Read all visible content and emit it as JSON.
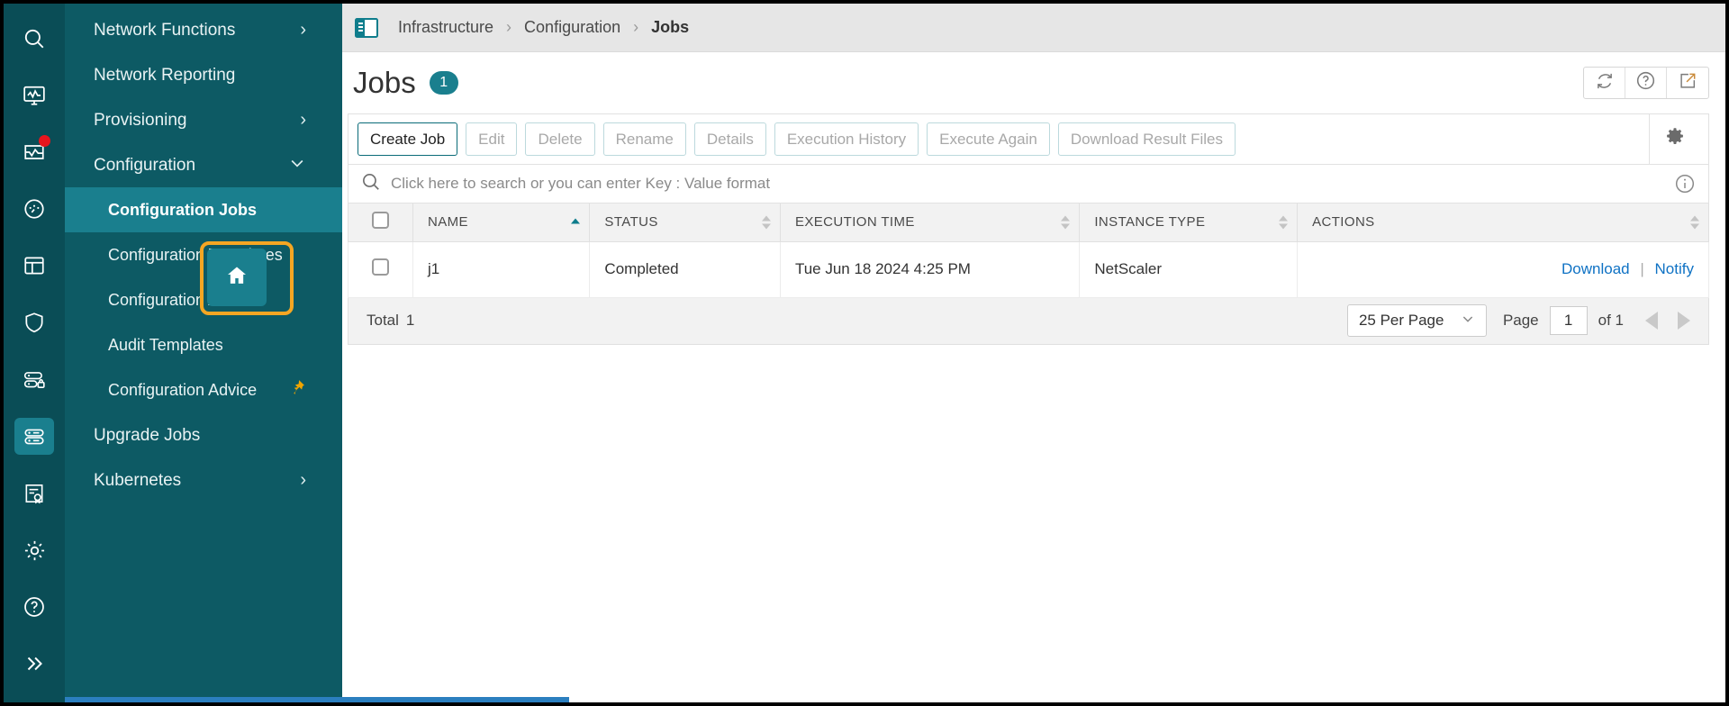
{
  "rail": {
    "items": [
      {
        "name": "search-icon",
        "label": "Search",
        "active": false,
        "badge": false
      },
      {
        "name": "dashboard-icon",
        "label": "Dashboard",
        "active": false,
        "badge": false
      },
      {
        "name": "events-icon",
        "label": "Events",
        "active": false,
        "badge": true
      },
      {
        "name": "gauge-icon",
        "label": "Analytics",
        "active": false,
        "badge": false
      },
      {
        "name": "applications-icon",
        "label": "Applications",
        "active": false,
        "badge": false
      },
      {
        "name": "security-icon",
        "label": "Security",
        "active": false,
        "badge": false
      },
      {
        "name": "instances-icon",
        "label": "Instances",
        "active": false,
        "badge": false
      },
      {
        "name": "infrastructure-icon",
        "label": "Infrastructure",
        "active": true,
        "badge": false
      },
      {
        "name": "licenses-icon",
        "label": "Licenses",
        "active": false,
        "badge": false
      },
      {
        "name": "settings-icon",
        "label": "Settings",
        "active": false,
        "badge": false
      },
      {
        "name": "help-icon",
        "label": "Help",
        "active": false,
        "badge": false
      },
      {
        "name": "expand-icon",
        "label": "Expand",
        "active": false,
        "badge": false
      }
    ]
  },
  "nav": {
    "items": [
      {
        "label": "Network Functions",
        "chevron": "›",
        "selected": false,
        "pinned": false
      },
      {
        "label": "Network Reporting",
        "chevron": "",
        "selected": false,
        "pinned": false
      },
      {
        "label": "Provisioning",
        "chevron": "›",
        "selected": false,
        "pinned": false
      },
      {
        "label": "Configuration",
        "chevron": "⌄",
        "selected": false,
        "pinned": false
      },
      {
        "label": "Configuration Jobs",
        "chevron": "",
        "selected": true,
        "pinned": false,
        "sub": true
      },
      {
        "label": "Configuration Templates",
        "chevron": "",
        "selected": false,
        "pinned": false,
        "sub": true
      },
      {
        "label": "Configuration Audit",
        "chevron": "",
        "selected": false,
        "pinned": false,
        "sub": true
      },
      {
        "label": "Audit Templates",
        "chevron": "",
        "selected": false,
        "pinned": false,
        "sub": true
      },
      {
        "label": "Configuration Advice",
        "chevron": "",
        "selected": false,
        "pinned": true,
        "sub": true
      },
      {
        "label": "Upgrade Jobs",
        "chevron": "",
        "selected": false,
        "pinned": false
      },
      {
        "label": "Kubernetes",
        "chevron": "›",
        "selected": false,
        "pinned": false
      }
    ],
    "home_tile_icon": "home-icon"
  },
  "breadcrumb": {
    "icon": "panel-layout-icon",
    "root": "Infrastructure",
    "separator": "›",
    "middle": "Configuration",
    "current": "Jobs"
  },
  "header": {
    "title": "Jobs",
    "count": "1",
    "actions": [
      {
        "name": "refresh-icon",
        "label": "Refresh"
      },
      {
        "name": "help-circle-icon",
        "label": "Help"
      },
      {
        "name": "open-external-icon",
        "label": "Open in new window"
      }
    ]
  },
  "toolbar": {
    "buttons": [
      {
        "label": "Create Job",
        "primary": true,
        "disabled": false
      },
      {
        "label": "Edit",
        "primary": false,
        "disabled": true
      },
      {
        "label": "Delete",
        "primary": false,
        "disabled": true
      },
      {
        "label": "Rename",
        "primary": false,
        "disabled": true
      },
      {
        "label": "Details",
        "primary": false,
        "disabled": true
      },
      {
        "label": "Execution History",
        "primary": false,
        "disabled": true
      },
      {
        "label": "Execute Again",
        "primary": false,
        "disabled": true
      },
      {
        "label": "Download Result Files",
        "primary": false,
        "disabled": true
      }
    ],
    "settings_icon": "gear-icon"
  },
  "search": {
    "icon": "search-icon",
    "placeholder": "Click here to search or you can enter Key : Value format",
    "value": "",
    "info_icon": "info-circle-icon"
  },
  "table": {
    "columns": [
      {
        "label": "",
        "key": "select",
        "sortable": false
      },
      {
        "label": "NAME",
        "key": "name",
        "sortable": true,
        "sort": "asc"
      },
      {
        "label": "STATUS",
        "key": "status",
        "sortable": true,
        "sort": "none"
      },
      {
        "label": "EXECUTION TIME",
        "key": "execution_time",
        "sortable": true,
        "sort": "none"
      },
      {
        "label": "INSTANCE TYPE",
        "key": "instance_type",
        "sortable": true,
        "sort": "none"
      },
      {
        "label": "ACTIONS",
        "key": "actions",
        "sortable": true,
        "sort": "none"
      }
    ],
    "rows": [
      {
        "selected": false,
        "name": "j1",
        "status": "Completed",
        "execution_time": "Tue Jun 18 2024 4:25 PM",
        "instance_type": "NetScaler",
        "action_download": "Download",
        "action_separator": "|",
        "action_notify": "Notify"
      }
    ]
  },
  "footer": {
    "total_label": "Total",
    "total_value": "1",
    "per_page": "25 Per Page",
    "page_label": "Page",
    "page_value": "1",
    "of_label": "of 1",
    "prev_icon": "chevron-left-icon",
    "next_icon": "chevron-right-icon"
  },
  "colors": {
    "rail_bg": "#0a4d56",
    "nav_bg": "#0d5a64",
    "accent": "#1a7f8e",
    "highlight": "#f5a623",
    "link": "#0f72c4",
    "badge_red": "#e8151d"
  }
}
